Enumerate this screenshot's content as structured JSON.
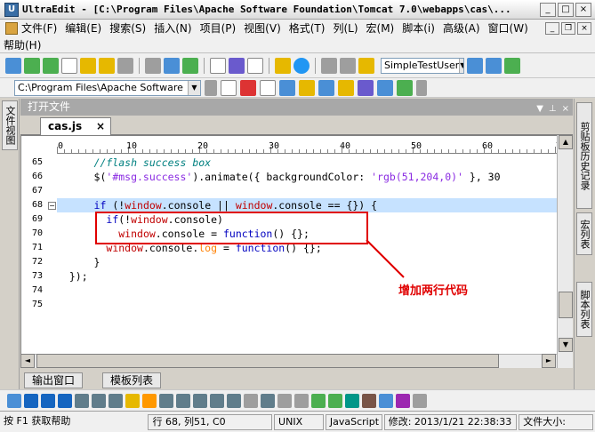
{
  "window": {
    "title": "UltraEdit - [C:\\Program Files\\Apache Software Foundation\\Tomcat 7.0\\webapps\\cas\\..."
  },
  "menu": {
    "items": [
      "文件(F)",
      "编辑(E)",
      "搜索(S)",
      "插入(N)",
      "项目(P)",
      "视图(V)",
      "格式(T)",
      "列(L)",
      "宏(M)",
      "脚本(i)",
      "高级(A)",
      "窗口(W)"
    ],
    "help": "帮助(H)"
  },
  "toolbar": {
    "user_combo": "SimpleTestUser",
    "path_combo": "C:\\Program Files\\Apache Software"
  },
  "left_dock": {
    "tab": "文件视图"
  },
  "right_dock": {
    "tabs": [
      "剪贴板历史记录",
      "宏列表",
      "脚本列表"
    ]
  },
  "panel": {
    "title": "打开文件"
  },
  "file_tab": {
    "label": "cas.js"
  },
  "ruler": {
    "labels": [
      "0",
      "10",
      "20",
      "30",
      "40",
      "50",
      "60",
      "7"
    ]
  },
  "editor": {
    "line_numbers": [
      "65",
      "66",
      "67",
      "68",
      "69",
      "70",
      "71",
      "72",
      "73",
      "74",
      "75"
    ],
    "lines": [
      "      //flash success box",
      "      $('#msg.success').animate({ backgroundColor: 'rgb(51,204,0)' }, 30",
      "",
      "      if (!window.console || window.console == {}) {",
      "        if(!window.console)",
      "          window.console = function() {};",
      "        window.console.log = function() {};",
      "      }",
      "  });",
      "",
      ""
    ],
    "highlight_line": "68"
  },
  "annotation": {
    "text": "增加两行代码"
  },
  "bottom_tabs": [
    "输出窗口",
    "模板列表"
  ],
  "status": {
    "help": "按 F1 获取帮助",
    "position": "行 68, 列51, C0",
    "line_ending": "UNIX",
    "language": "JavaScript",
    "modified": "修改: 2013/1/21 22:38:33",
    "filesize": "文件大小:"
  }
}
